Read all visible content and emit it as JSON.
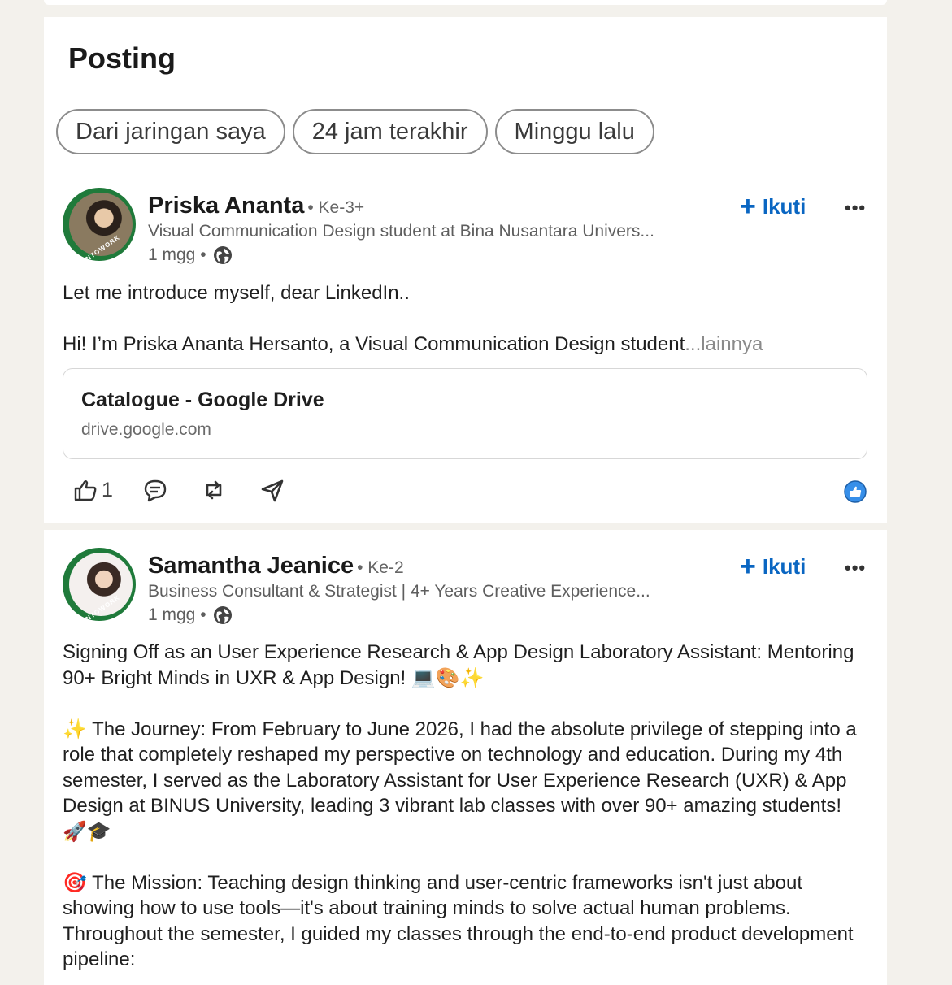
{
  "section": {
    "title": "Posting"
  },
  "filters": [
    "Dari jaringan saya",
    "24 jam terakhir",
    "Minggu lalu"
  ],
  "posts": [
    {
      "author": "Priska Ananta",
      "degree": "• Ke-3+",
      "headline": "Visual Communication Design student at Bina Nusantara Univers...",
      "time": "1 mgg •",
      "follow_label": "Ikuti",
      "more_label": "•••",
      "avatar_badge": "#OPENTOWORK",
      "lines": [
        "Let me introduce myself, dear LinkedIn..",
        "",
        "Hi! I’m Priska Ananta Hersanto, a Visual Communication Design student"
      ],
      "see_more": "...lainnya",
      "link": {
        "title": "Catalogue - Google Drive",
        "url": "drive.google.com"
      },
      "like_count": "1"
    },
    {
      "author": "Samantha Jeanice",
      "degree": "• Ke-2",
      "headline": "Business Consultant & Strategist | 4+ Years Creative Experience...",
      "time": "1 mgg •",
      "follow_label": "Ikuti",
      "more_label": "•••",
      "avatar_badge": "#OPENTOWORK",
      "paragraphs": [
        "Signing Off as an User Experience Research & App Design Laboratory Assistant: Mentoring 90+ Bright Minds in UXR & App Design! 💻🎨✨",
        "✨ The Journey: From February to June 2026, I had the absolute privilege of stepping into a role that completely reshaped my perspective on technology and education. During my 4th semester, I served as the Laboratory Assistant for User Experience Research (UXR) & App Design at BINUS University, leading 3 vibrant lab classes with over 90+ amazing students! 🚀🎓",
        "🎯 The Mission: Teaching design thinking and user-centric frameworks isn't just about showing how to use tools—it's about training minds to solve actual human problems. Throughout the semester, I guided my classes through the end-to-end product development pipeline:"
      ]
    }
  ]
}
